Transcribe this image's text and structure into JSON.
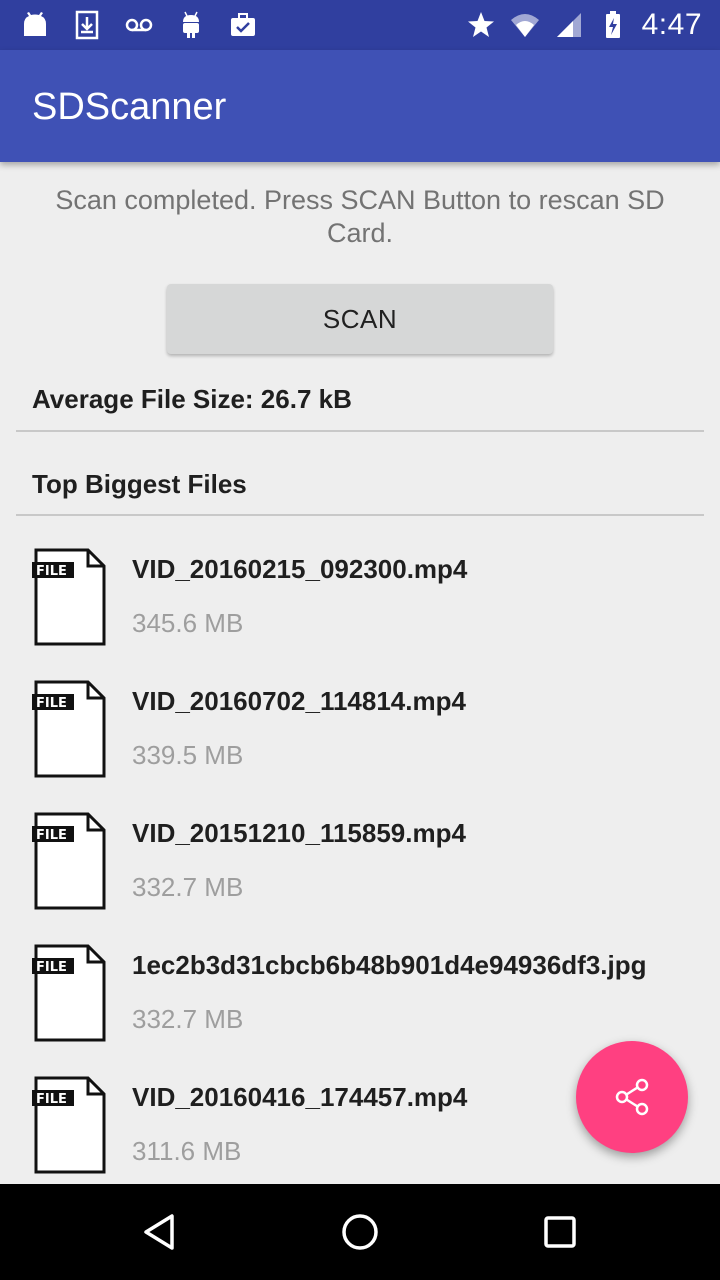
{
  "status_bar": {
    "time": "4:47",
    "left_icons": [
      "android-alert-icon",
      "download-icon",
      "voicemail-icon",
      "android-icon",
      "briefcase-check-icon"
    ],
    "right_icons": [
      "star-icon",
      "wifi-icon",
      "signal-icon",
      "battery-charging-icon"
    ],
    "background": "#303f9f"
  },
  "app_bar": {
    "title": "SDScanner",
    "background": "#3f51b5"
  },
  "main": {
    "status_message": "Scan completed. Press SCAN Button to rescan SD Card.",
    "scan_button_label": "SCAN",
    "average_file_size": "Average File Size: 26.7 kB",
    "section_title": "Top Biggest Files",
    "file_icon_label": "FILE",
    "files": [
      {
        "name": "VID_20160215_092300.mp4",
        "size": "345.6 MB"
      },
      {
        "name": "VID_20160702_114814.mp4",
        "size": "339.5 MB"
      },
      {
        "name": "VID_20151210_115859.mp4",
        "size": "332.7 MB"
      },
      {
        "name": "1ec2b3d31cbcb6b48b901d4e94936df3.jpg",
        "size": "332.7 MB"
      },
      {
        "name": "VID_20160416_174457.mp4",
        "size": "311.6 MB"
      }
    ]
  },
  "fab": {
    "icon": "share-icon",
    "color": "#ff4081"
  },
  "nav_bar": {
    "buttons": [
      "back-icon",
      "home-icon",
      "recent-apps-icon"
    ]
  }
}
